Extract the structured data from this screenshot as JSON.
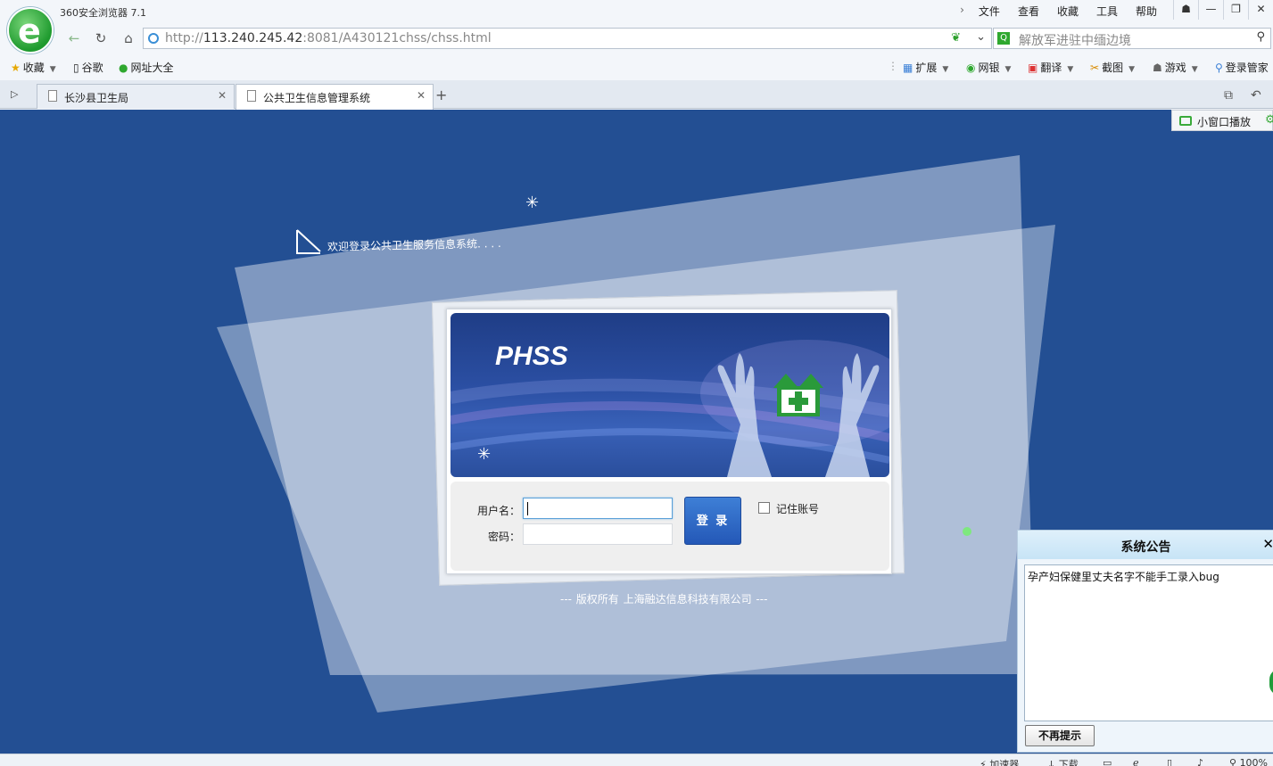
{
  "browser": {
    "app_title": "360安全浏览器 7.1",
    "menu": [
      "文件",
      "查看",
      "收藏",
      "工具",
      "帮助"
    ],
    "url_prefix": "http://",
    "url_host": "113.240.245.42",
    "url_rest": ":8081/A430121chss/chss.html",
    "search_placeholder": "解放军进驻中缅边境"
  },
  "bookmarks": {
    "left": [
      "收藏",
      "谷歌",
      "网址大全"
    ],
    "right": [
      "扩展",
      "网银",
      "翻译",
      "截图",
      "游戏",
      "登录管家"
    ]
  },
  "tabs": [
    {
      "label": "长沙县卫生局"
    },
    {
      "label": "公共卫生信息管理系统"
    }
  ],
  "page": {
    "mini_player": "小窗口播放",
    "welcome": "欢迎登录公共卫生服务信息系统. . . .",
    "logo_text": "PHSS",
    "username_label": "用户名：",
    "password_label": "密码：",
    "login_button": "登 录",
    "remember_label": "记住账号",
    "copyright": "---  版权所有  上海融达信息科技有限公司  ---"
  },
  "notice": {
    "title": "系统公告",
    "text": "孕产妇保健里丈夫名字不能手工录入bug",
    "dismiss": "不再提示"
  },
  "status": {
    "accelerator": "加速器",
    "download": "下载",
    "zoom": "100%"
  },
  "colors": {
    "page_bg": "#234f93",
    "accent_green": "#2fa82f",
    "login_button": "#2458b7"
  }
}
